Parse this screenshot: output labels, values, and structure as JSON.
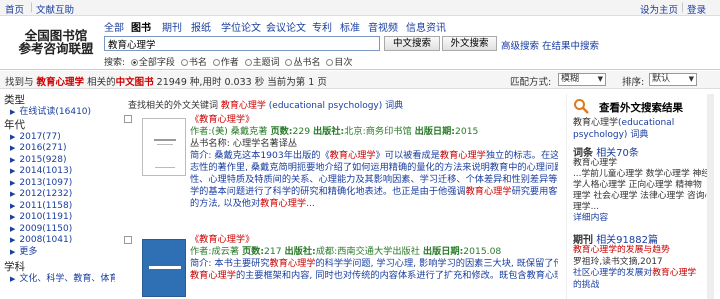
{
  "top": {
    "home": "首页",
    "feedback": "文献互助",
    "set_home": "设为主页",
    "login": "登录"
  },
  "logo": {
    "line1": "全国图书馆",
    "line2": "参考咨询联盟"
  },
  "tabs": [
    "全部",
    "图书",
    "期刊",
    "报纸",
    "学位论文",
    "会议论文",
    "专利",
    "标准",
    "音视频",
    "信息资讯"
  ],
  "search": {
    "value": "教育心理学",
    "btn_cn": "中文搜索",
    "btn_foreign": "外文搜索",
    "advanced": "高级搜索",
    "in_results": "在结果中搜索"
  },
  "scope": {
    "label": "搜索:",
    "options": [
      "全部字段",
      "书名",
      "作者",
      "主题词",
      "丛书名",
      "目次"
    ]
  },
  "result": {
    "prefix": "找到与",
    "kw": "教育心理学",
    "mid": "相关的",
    "type": "中文图书",
    "count": "21949",
    "unit": "种,用时",
    "time": "0.033",
    "sec": "秒",
    "page": "当前为第 1 页",
    "match_label": "匹配方式:",
    "match_value": "模糊",
    "sort_label": "排序:",
    "sort_value": "默认"
  },
  "left": {
    "cat_title": "类型",
    "cat_items": [
      "在线试读(16410)"
    ],
    "year_title": "年代",
    "years": [
      "2017(77)",
      "2016(271)",
      "2015(928)",
      "2014(1013)",
      "2013(1097)",
      "2012(1232)",
      "2011(1158)",
      "2010(1191)",
      "2009(1150)",
      "2008(1041)",
      "更多"
    ],
    "subj_title": "学科",
    "subj_items": [
      "文化、科学、教育、体育"
    ]
  },
  "main": {
    "related_prefix": "查找相关的外文关键词",
    "related_kw": "教育心理学",
    "related_en": "(educational psychology)",
    "related_dict": "词典",
    "rec1": {
      "title": "《教育心理学》",
      "author_label": "作者:",
      "author": "(美) 桑戴克著",
      "pages_label": "页数:",
      "pages": "229",
      "pub_label": "出版社:",
      "pub": "北京:商务印书馆",
      "date_label": "出版日期:",
      "date": "2015",
      "series": "丛书名称: 心理学名著译丛",
      "abs_lines": [
        "简介: 桑戴克这本1903年出版的《教育心理学》可以被看成是教育心理学独立的标志。在这本标",
        "志性的著作里, 桑戴克简明扼要地介绍了如何运用精确的量化的方法来说明教育中的心理问题, 他对于人的本",
        "性、心理特质及特质间的关系、心理能力及其影响因素、学习迁移、个体差异和性别差异等教育心理",
        "学的基本问题进行了科学的研究和精确化地表述。也正是由于他强调教育心理学研究要用客观化",
        "的方法, 以及他对教育心理学..."
      ]
    },
    "rec2": {
      "title": "《教育心理学》",
      "author_label": "作者:",
      "author": "成云著",
      "pages_label": "页数:",
      "pages": "217",
      "pub_label": "出版社:",
      "pub": "成都:西南交通大学出版社",
      "date_label": "出版日期:",
      "date": "2015.08",
      "abs_lines": [
        "简介: 本书主要研究教育心理学的科学学问题, 学习心理, 影响学习的因素三大块, 既保留了传统",
        "教育心理学的主要框架和内容, 同时也对传统的内容体系进行了扩充和修改。既包含教育心理"
      ]
    }
  },
  "right": {
    "ext_title": "查看外文搜索结果",
    "ext_kw": "教育心理学",
    "ext_en": "(educational psychology)",
    "ext_dict": "词典",
    "ci_title": "词条",
    "ci_count": "相关70条",
    "ci_kw": "教育心理学",
    "ci_lines": [
      "...学前儿童心理学 数学心理学 神经心理",
      "学人格心理学 正向心理学 精神物",
      "理学 社会心理学 法律心理学 咨询心",
      "理学..."
    ],
    "ci_more": "详细内容",
    "per_title": "期刊",
    "per_count": "相关91882篇",
    "per_lines": [
      "教育心理学的发展与趋势",
      "罗祖玲,读书文摘,2017",
      "社区心理学的发展对教育心理学",
      "的挑战"
    ]
  },
  "colors": {
    "accent": "#1a3ea0",
    "keyword": "#c00",
    "meta": "#2a7a2a"
  }
}
